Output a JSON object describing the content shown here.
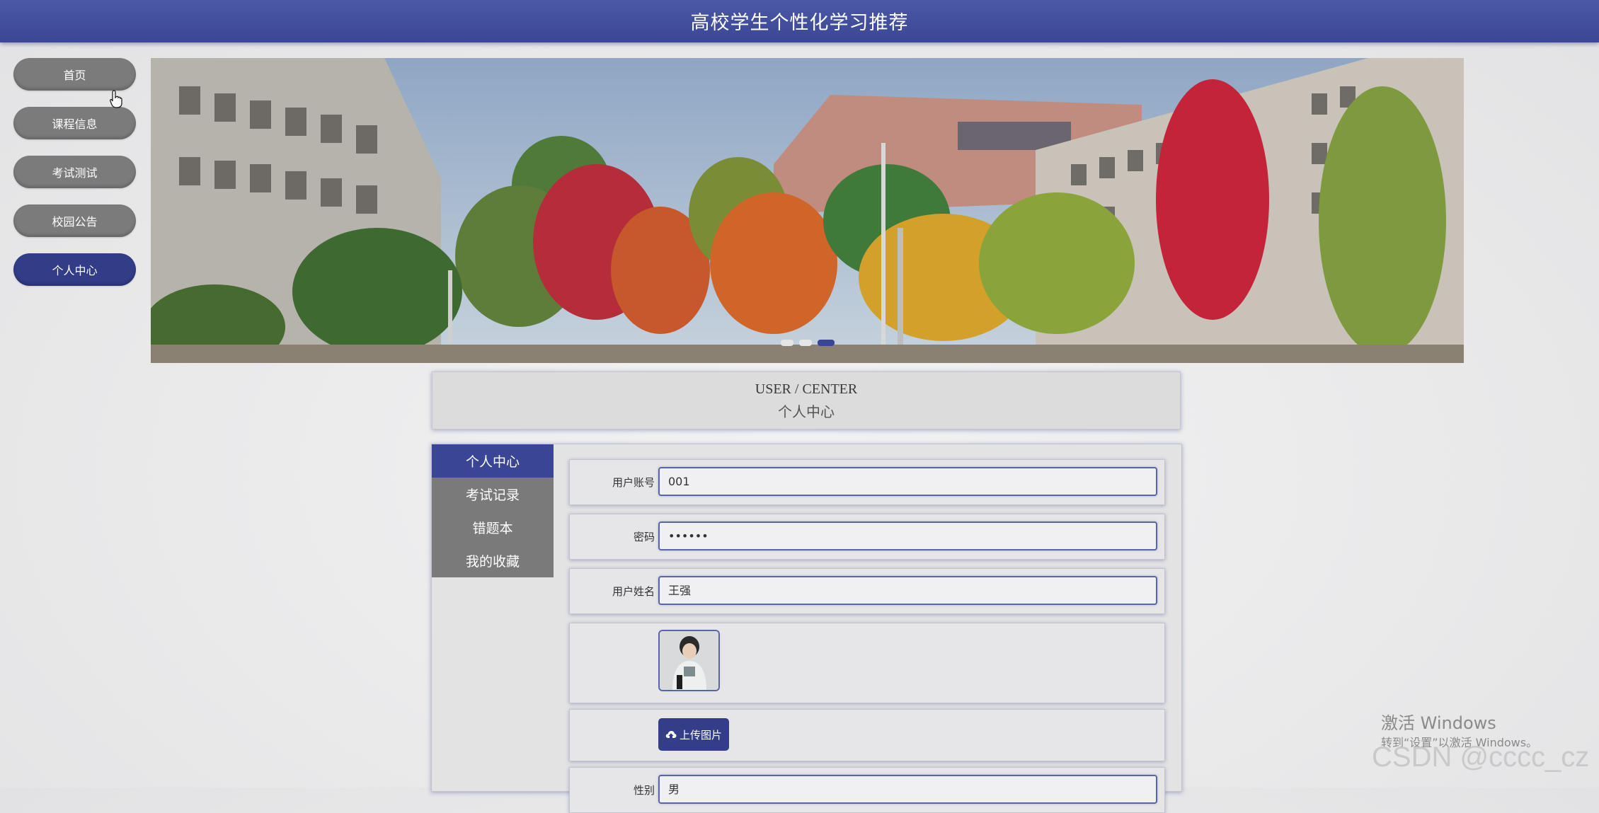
{
  "header": {
    "title": "高校学生个性化学习推荐"
  },
  "nav": {
    "items": [
      {
        "label": "首页"
      },
      {
        "label": "课程信息"
      },
      {
        "label": "考试测试"
      },
      {
        "label": "校园公告"
      },
      {
        "label": "个人中心"
      }
    ],
    "active_index": 4
  },
  "banner": {
    "slide_count": 3,
    "active_slide": 3
  },
  "user_center": {
    "title_en": "USER / CENTER",
    "title_cn": "个人中心"
  },
  "side_menu": {
    "items": [
      {
        "label": "个人中心"
      },
      {
        "label": "考试记录"
      },
      {
        "label": "错题本"
      },
      {
        "label": "我的收藏"
      }
    ],
    "active_index": 0
  },
  "form": {
    "account": {
      "label": "用户账号",
      "value": "001"
    },
    "password": {
      "label": "密码",
      "value": "••••••"
    },
    "name": {
      "label": "用户姓名",
      "value": "王强"
    },
    "upload_label": "上传图片",
    "gender": {
      "label": "性别",
      "value": "男"
    }
  },
  "watermark": {
    "activate_title": "激活 Windows",
    "activate_hint": "转到“设置”以激活 Windows。",
    "csdn": "CSDN @cccc_cz"
  },
  "colors": {
    "primary": "#3a4596",
    "nav_gray": "#7b7b7b",
    "header": "#4a58a6"
  }
}
